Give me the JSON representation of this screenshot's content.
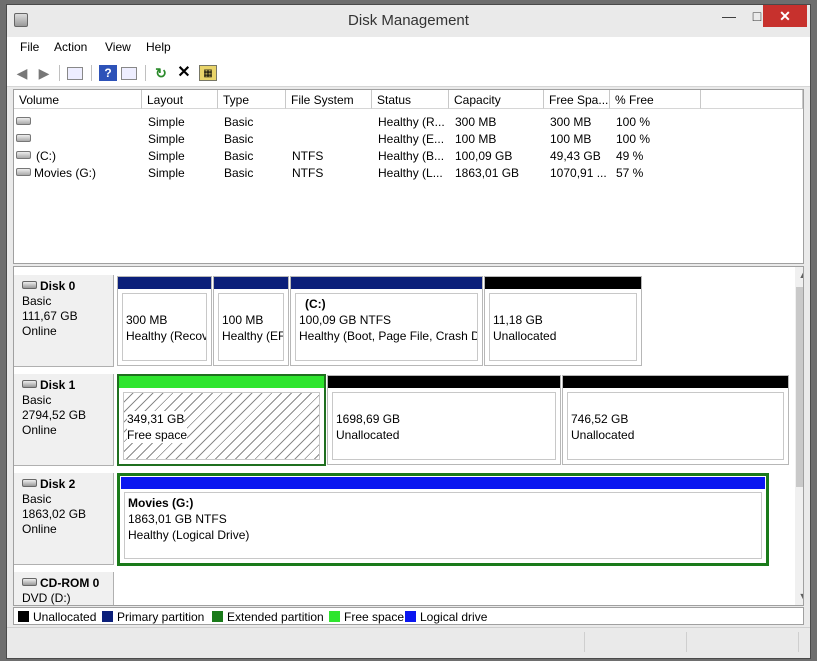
{
  "window": {
    "title": "Disk Management"
  },
  "menu": [
    "File",
    "Action",
    "View",
    "Help"
  ],
  "toolbar": {
    "icons": [
      "back-icon",
      "forward-icon",
      "console-tree-icon",
      "help-icon",
      "properties-icon",
      "refresh-icon",
      "delete-icon",
      "rescan-icon"
    ]
  },
  "volume_table": {
    "columns": [
      "Volume",
      "Layout",
      "Type",
      "File System",
      "Status",
      "Capacity",
      "Free Spa...",
      "% Free"
    ],
    "rows": [
      {
        "volume": "",
        "layout": "Simple",
        "type": "Basic",
        "fs": "",
        "status": "Healthy (R...",
        "capacity": "300 MB",
        "free": "300 MB",
        "pct": "100 %"
      },
      {
        "volume": "",
        "layout": "Simple",
        "type": "Basic",
        "fs": "",
        "status": "Healthy (E...",
        "capacity": "100 MB",
        "free": "100 MB",
        "pct": "100 %"
      },
      {
        "volume": "(C:)",
        "layout": "Simple",
        "type": "Basic",
        "fs": "NTFS",
        "status": "Healthy (B...",
        "capacity": "100,09 GB",
        "free": "49,43 GB",
        "pct": "49 %"
      },
      {
        "volume": "Movies (G:)",
        "layout": "Simple",
        "type": "Basic",
        "fs": "NTFS",
        "status": "Healthy (L...",
        "capacity": "1863,01 GB",
        "free": "1070,91 ...",
        "pct": "57 %"
      }
    ]
  },
  "disks": [
    {
      "name": "Disk 0",
      "kind": "Basic",
      "size": "111,67 GB",
      "state": "Online",
      "partitions": [
        {
          "title": "",
          "line1": "300 MB",
          "line2": "Healthy (Recov",
          "bar": "#0b1f7a"
        },
        {
          "title": "",
          "line1": "100 MB",
          "line2": "Healthy (EF",
          "bar": "#0b1f7a"
        },
        {
          "title": "(C:)",
          "line1": "100,09 GB NTFS",
          "line2": "Healthy (Boot, Page File, Crash Du",
          "bar": "#0b1f7a"
        },
        {
          "title": "",
          "line1": "11,18 GB",
          "line2": "Unallocated",
          "bar": "#000000"
        }
      ]
    },
    {
      "name": "Disk 1",
      "kind": "Basic",
      "size": "2794,52 GB",
      "state": "Online",
      "partitions": [
        {
          "title": "",
          "line1": "349,31 GB",
          "line2": "Free space",
          "bar": "#2ee52e"
        },
        {
          "title": "",
          "line1": "1698,69 GB",
          "line2": "Unallocated",
          "bar": "#000000"
        },
        {
          "title": "",
          "line1": "746,52 GB",
          "line2": "Unallocated",
          "bar": "#000000"
        }
      ]
    },
    {
      "name": "Disk 2",
      "kind": "Basic",
      "size": "1863,02 GB",
      "state": "Online",
      "partitions": [
        {
          "title": "Movies  (G:)",
          "line1": "1863,01 GB NTFS",
          "line2": "Healthy (Logical Drive)",
          "bar": "#0a16f0"
        }
      ]
    },
    {
      "name": "CD-ROM 0",
      "kind": "DVD (D:)",
      "size": "",
      "state": "",
      "partitions": []
    }
  ],
  "legend": [
    {
      "label": "Unallocated",
      "color": "#000000"
    },
    {
      "label": "Primary partition",
      "color": "#0b1f7a"
    },
    {
      "label": "Extended partition",
      "color": "#1a7a1a"
    },
    {
      "label": "Free space",
      "color": "#2ee52e"
    },
    {
      "label": "Logical drive",
      "color": "#0a16f0"
    }
  ]
}
